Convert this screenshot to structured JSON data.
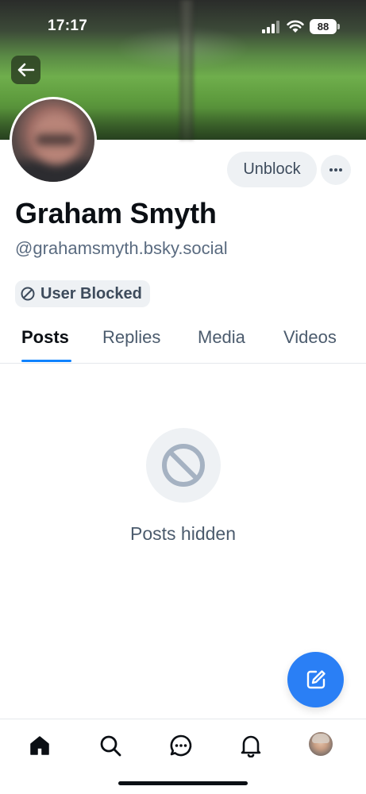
{
  "status_bar": {
    "time": "17:17",
    "battery": "88"
  },
  "profile": {
    "display_name": "Graham Smyth",
    "handle": "@grahamsmyth.bsky.social",
    "blocked_badge": "User Blocked",
    "unblock_label": "Unblock"
  },
  "tabs": [
    {
      "label": "Posts",
      "active": true
    },
    {
      "label": "Replies",
      "active": false
    },
    {
      "label": "Media",
      "active": false
    },
    {
      "label": "Videos",
      "active": false
    }
  ],
  "empty_state": {
    "icon": "ban-icon",
    "message": "Posts hidden"
  },
  "bottom_nav": {
    "items": [
      "home-icon",
      "search-icon",
      "chat-icon",
      "bell-icon",
      "profile-avatar"
    ]
  },
  "colors": {
    "accent": "#1083fe",
    "fab": "#2a7ff5",
    "muted_text": "#5a6b80",
    "chip_bg": "#eef1f4"
  }
}
